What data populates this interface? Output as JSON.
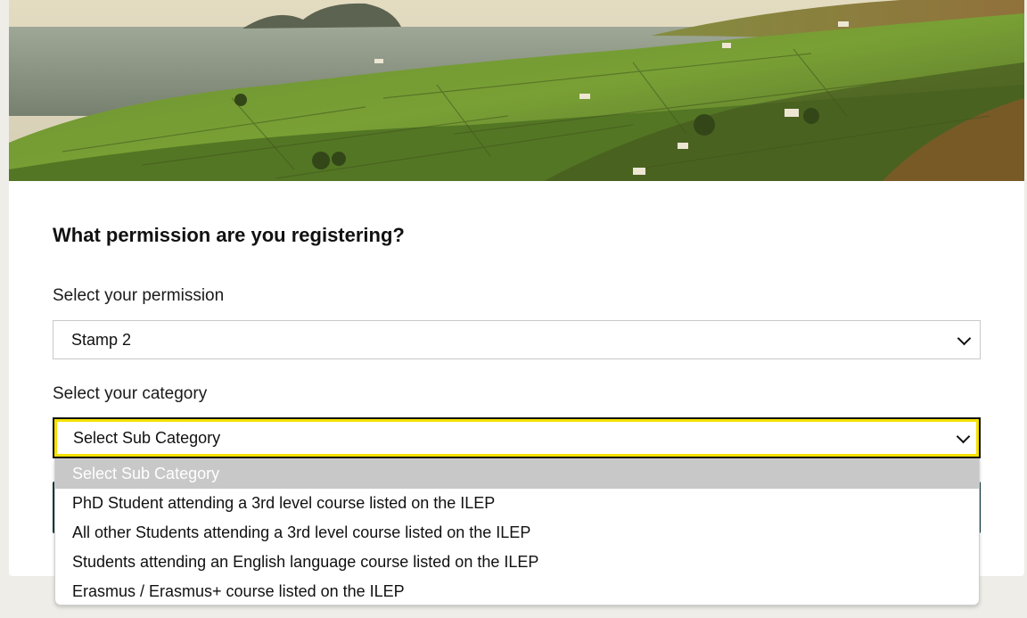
{
  "form": {
    "heading": "What permission are you registering?",
    "permission_label": "Select your permission",
    "permission_value": "Stamp 2",
    "category_label": "Select your category",
    "category_value": "Select Sub Category"
  },
  "dropdown": {
    "options": [
      "Select Sub Category",
      "PhD Student attending a 3rd level course listed on the ILEP",
      "All other Students attending a 3rd level course listed on the ILEP",
      "Students attending an English language course listed on the ILEP",
      "Erasmus / Erasmus+ course listed on the ILEP"
    ],
    "highlighted_index": 0
  },
  "colors": {
    "focus_outline": "#f5e100",
    "highlight_bg": "#c8c8c8"
  }
}
